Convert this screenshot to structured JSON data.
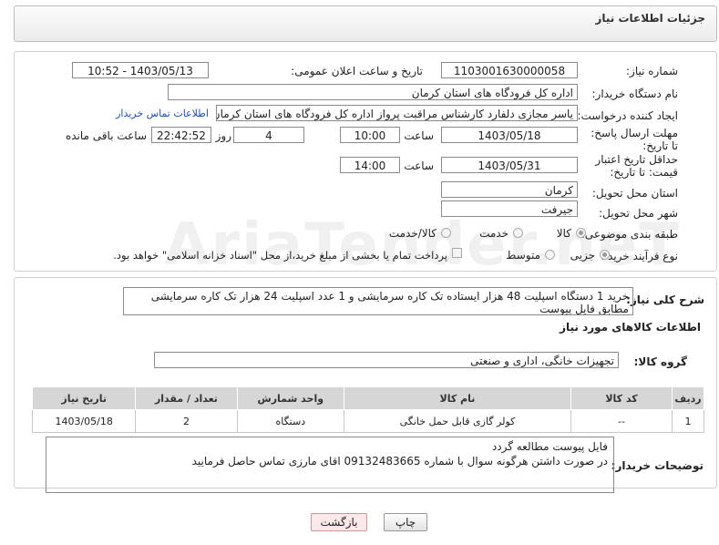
{
  "header": {
    "title": "جزئیات اطلاعات نیاز"
  },
  "form": {
    "need_number_label": "شماره نیاز:",
    "need_number": "1103001630000058",
    "announce_label": "تاریخ و ساعت اعلان عمومی:",
    "announce_value": "1403/05/13 - 10:52",
    "buyer_label": "نام دستگاه خریدار:",
    "buyer_value": "اداره کل فرودگاه های استان کرمان",
    "creator_label": "ایجاد کننده درخواست:",
    "creator_value": "یاسر مجازی دلفارد کارشناس مراقبت پرواز اداره کل فرودگاه های استان کرمان",
    "buyer_contact_link": "اطلاعات تماس خریدار",
    "deadline_label": "مهلت ارسال پاسخ: تا تاریخ:",
    "deadline_date": "1403/05/18",
    "time_label": "ساعت",
    "deadline_time": "10:00",
    "days_value": "4",
    "days_label": "روز و",
    "remaining_time": "22:42:52",
    "remaining_label": "ساعت باقی مانده",
    "validity_label": "حداقل تاریخ اعتبار قیمت: تا تاریخ:",
    "validity_date": "1403/05/31",
    "validity_time": "14:00",
    "province_label": "استان محل تحویل:",
    "province_value": "کرمان",
    "city_label": "شهر محل تحویل:",
    "city_value": "جیرفت",
    "category_label": "طبقه بندی موضوعی:",
    "category_options": [
      "کالا",
      "خدمت",
      "کالا/خدمت"
    ],
    "category_selected": "کالا",
    "process_label": "نوع فرآیند خرید :",
    "process_options": [
      "جزیی",
      "متوسط"
    ],
    "process_selected": "جزیی",
    "payment_note": "پرداخت تمام یا بخشی از مبلغ خرید،از محل \"اسناد خزانه اسلامی\" خواهد بود."
  },
  "description": {
    "label": "شرح کلی نیاز:",
    "text": "خرید 1 دستگاه اسپلیت 48 هزار ایستاده تک کاره سرمایشی  و 1 عدد اسپلیت 24 هزار تک کاره سرمایشی مطابق فایل پیوست"
  },
  "goods": {
    "section_title": "اطلاعات کالاهای مورد نیاز",
    "group_label": "گروه کالا:",
    "group_value": "تجهیزات خانگی، اداری و صنعتی",
    "table": {
      "headers": [
        "ردیف",
        "کد کالا",
        "نام کالا",
        "واحد شمارش",
        "تعداد / مقدار",
        "تاریخ نیاز"
      ],
      "rows": [
        [
          "1",
          "--",
          "کولر گازی قابل حمل خانگی",
          "دستگاه",
          "2",
          "1403/05/18"
        ]
      ]
    }
  },
  "buyer_notes": {
    "label": "توضیحات خریدار:",
    "line1": "فایل پیوست مطالعه گردد",
    "line2": "در صورت داشتن هرگونه سوال با شماره 09132483665 اقای مارزی تماس حاصل فرمایید"
  },
  "buttons": {
    "print": "چاپ",
    "back": "بازگشت"
  },
  "watermark": "AriaTender.neT"
}
